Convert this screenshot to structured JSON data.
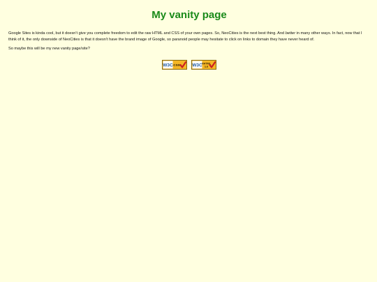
{
  "heading": "My vanity page",
  "paragraph1": {
    "before": "Google Sites is kinda cool, but it doesn't give you complete freedom to edit the raw HTML and CSS of your own pages. So, NeoCities is the next best thing. And ",
    "emphasis": "better",
    "after": " in many other ways. In fact, now that I think of it, the only downside of NeoCities is that it doesn't have the brand image of Google, so paranoid people may hesitate to click on links to domain they have never heard of."
  },
  "paragraph2": "So maybe this will be my new vanity page/site?",
  "badges": [
    {
      "mark": "W3C",
      "label": "CSS",
      "icon": "w3c-css-valid-badge"
    },
    {
      "mark": "W3C",
      "label": "XHTML",
      "sublabel": "1.0",
      "icon": "w3c-xhtml-valid-badge"
    }
  ],
  "colors": {
    "background": "#ffffe0",
    "heading": "#1a8a1a",
    "badge_gold": "#f5b625",
    "w3c_blue": "#1f5aa0",
    "check_red": "#cc2020"
  }
}
